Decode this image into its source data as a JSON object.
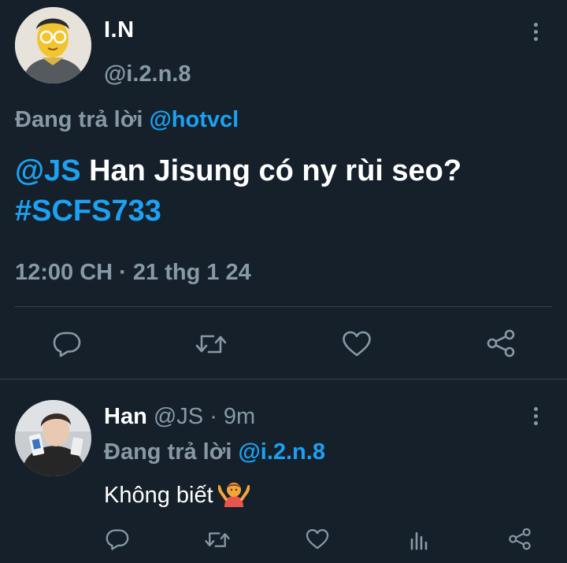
{
  "tweet": {
    "author_name": "I.N",
    "author_handle": "@i.2.n.8",
    "replying_prefix": "Đang trả lời",
    "replying_to": "@hotvcl",
    "mention": "@JS",
    "text": " Han Jisung có ny rùi seo?",
    "hashtag": "#SCFS733",
    "timestamp": "12:00 CH · 21 thg 1 24"
  },
  "reply": {
    "author_name": "Han",
    "author_handle": "@JS",
    "time": " · 9m",
    "replying_prefix": "Đang trả lời",
    "replying_to": "@i.2.n.8",
    "text": "Không biết"
  },
  "icons": {
    "more": "more-vertical-icon",
    "reply": "reply-icon",
    "retweet": "retweet-icon",
    "like": "heart-icon",
    "share": "share-icon",
    "analytics": "analytics-icon",
    "emoji": "person-shrugging-emoji"
  },
  "colors": {
    "background": "#15202b",
    "text": "#ffffff",
    "secondary": "#8899a6",
    "accent": "#1da1f2",
    "divider": "#38444d"
  }
}
